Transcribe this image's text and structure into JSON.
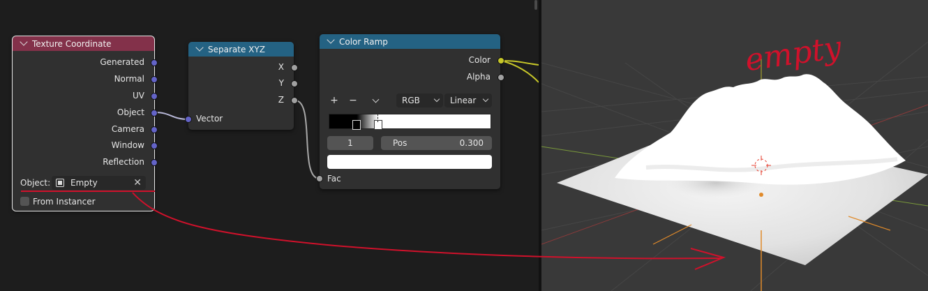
{
  "texture_coordinate": {
    "title": "Texture Coordinate",
    "outputs": [
      "Generated",
      "Normal",
      "UV",
      "Object",
      "Camera",
      "Window",
      "Reflection"
    ],
    "object_label": "Object:",
    "object_value": "Empty",
    "from_instancer_label": "From Instancer",
    "from_instancer_checked": false
  },
  "separate_xyz": {
    "title": "Separate XYZ",
    "outputs": [
      "X",
      "Y",
      "Z"
    ],
    "input": "Vector"
  },
  "color_ramp": {
    "title": "Color Ramp",
    "outputs": [
      "Color",
      "Alpha"
    ],
    "add_label": "+",
    "remove_label": "−",
    "color_mode": "RGB",
    "interpolation": "Linear",
    "stop_index": "1",
    "pos_label": "Pos",
    "pos_value": "0.300",
    "input": "Fac"
  },
  "viewport": {
    "annotation": "empty"
  },
  "colors": {
    "texture_header": "#83314a",
    "converter_header": "#246283",
    "vector_socket": "#6363c7",
    "float_socket": "#a1a1a1",
    "color_socket": "#c7c729",
    "annotation_red": "#d0112b"
  }
}
